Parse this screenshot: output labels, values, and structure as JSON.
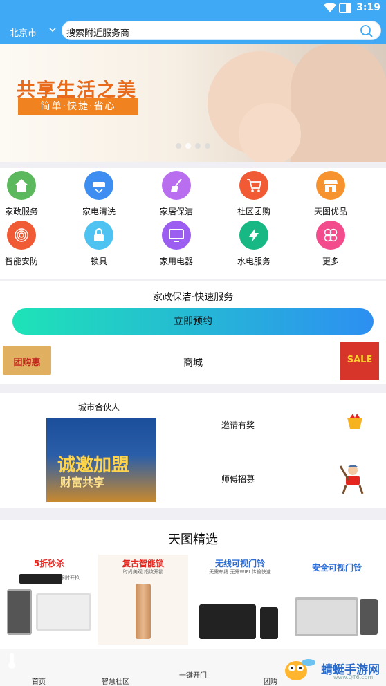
{
  "status": {
    "time": "3:19"
  },
  "header": {
    "city": "北京市",
    "search_placeholder": "搜索附近服务商"
  },
  "banner": {
    "slogan": "共享生活之美",
    "subtitle": "简单·快捷·省心"
  },
  "categories": [
    {
      "label": "家政服务",
      "icon": "home-icon",
      "color": "#5cb85c"
    },
    {
      "label": "家电清洗",
      "icon": "ac-icon",
      "color": "#3d8ef0"
    },
    {
      "label": "家居保洁",
      "icon": "broom-icon",
      "color": "#b96ef0"
    },
    {
      "label": "社区团购",
      "icon": "cart-icon",
      "color": "#f05a35"
    },
    {
      "label": "天图优品",
      "icon": "shop-icon",
      "color": "#f7932f"
    },
    {
      "label": "智能安防",
      "icon": "fingerprint-icon",
      "color": "#f05a35"
    },
    {
      "label": "锁具",
      "icon": "lock-icon",
      "color": "#4ec2f0"
    },
    {
      "label": "家用电器",
      "icon": "tv-icon",
      "color": "#9b5ef0"
    },
    {
      "label": "水电服务",
      "icon": "bolt-icon",
      "color": "#17b884"
    },
    {
      "label": "更多",
      "icon": "more-icon",
      "color": "#f24c8c"
    }
  ],
  "promo": {
    "title": "家政保洁·快速服务",
    "button": "立即预约",
    "mall": "商城",
    "badge_left": "团购惠",
    "badge_right": "SALE"
  },
  "partner": {
    "heading": "城市合伙人",
    "poster_line1": "诚邀加盟",
    "poster_line2": "财富共享",
    "invite": "邀请有奖",
    "master": "师傅招募"
  },
  "selection": {
    "title": "天图精选",
    "products": [
      {
        "title": "5折秒杀",
        "sub": "限时开抢",
        "color": "#e5261f"
      },
      {
        "title": "复古智能锁",
        "sub": "时尚美观 指纹开锁",
        "color": "#e5261f"
      },
      {
        "title": "无线可视门铃",
        "sub": "无需布线 无需WIFI 传输快速",
        "color": "#2c6ed8"
      },
      {
        "title": "安全可视门铃",
        "sub": "",
        "color": "#2c6ed8"
      }
    ]
  },
  "nav": {
    "home": "首页",
    "community": "智慧社区",
    "center": "一键开门",
    "groupbuy": "团购"
  },
  "watermark": {
    "name": "蜻蜓手游网",
    "url": "www.QT6.com"
  }
}
